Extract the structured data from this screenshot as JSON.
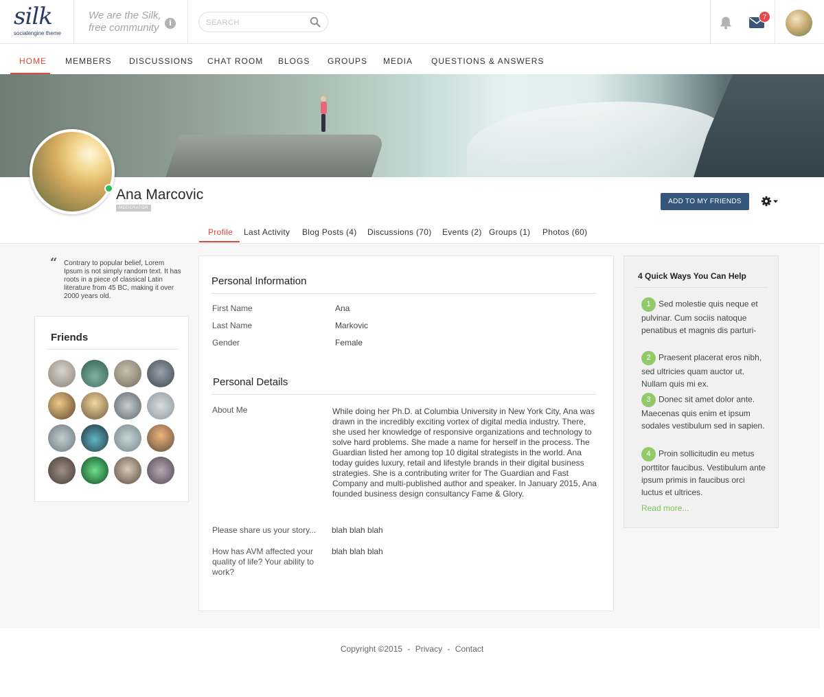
{
  "header": {
    "logo_word": "silk",
    "logo_sub": "socialengine theme",
    "tagline": "We are the Silk, free community",
    "info_glyph": "i",
    "search_placeholder": "SEARCH",
    "mail_count": "7"
  },
  "nav": {
    "items": [
      "HOME",
      "MEMBERS",
      "DISCUSSIONS",
      "CHAT ROOM",
      "BLOGS",
      "GROUPS",
      "MEDIA",
      "QUESTIONS & ANSWERS"
    ],
    "active": "HOME"
  },
  "profile": {
    "name": "Ana Marcovic",
    "badge": "MODERATOR",
    "status": "online",
    "add_friend_label": "ADD TO MY FRIENDS",
    "tabs": [
      "Profile",
      "Last Activity",
      "Blog Posts (4)",
      "Discussions (70)",
      "Events (2)",
      "Groups (1)",
      "Photos (60)"
    ],
    "active_tab": "Profile"
  },
  "quote": "Contrary to popular belief, Lorem Ipsum is not simply random text. It has roots in a piece of classical Latin literature from 45 BC, making it over 2000 years old.",
  "friends": {
    "title": "Friends",
    "count": 16
  },
  "personal_info": {
    "title": "Personal Information",
    "fields": [
      {
        "label": "First Name",
        "value": "Ana"
      },
      {
        "label": "Last Name",
        "value": "Markovic"
      },
      {
        "label": "Gender",
        "value": "Female"
      }
    ]
  },
  "personal_details": {
    "title": "Personal Details",
    "about_label": "About Me",
    "about_text": "While doing her Ph.D. at Columbia University in New York City, Ana was drawn in the incredibly exciting vortex of digital media industry. There, she used her knowledge of responsive organizations and technology to solve hard problems. She made a name for herself in the process. The Guardian listed her among top 10 digital strategists in the world. Ana today guides luxury, retail and lifestyle brands in their digital business strategies. She is a contributing writer for The Guardian and Fast Company and multi-published author and speaker. In January 2015, Ana founded business design consultancy Fame & Glory.",
    "story_label": "Please share us your story...",
    "story_value": "blah blah blah",
    "avm_label": "How has AVM affected your quality of life? Your ability to work?",
    "avm_value": "blah blah blah"
  },
  "help": {
    "title": "4 Quick Ways You Can Help",
    "items": [
      {
        "num": "1",
        "text": "Sed molestie quis neque et pulvinar. Cum sociis natoque penatibus et magnis dis parturi-"
      },
      {
        "num": "2",
        "text": "Praesent placerat eros nibh, sed ultricies quam auctor ut. Nullam quis mi ex."
      },
      {
        "num": "3",
        "text": "Donec sit amet dolor ante. Maecenas quis enim et ipsum sodales vestibulum sed in sapien."
      },
      {
        "num": "4",
        "text": "Proin sollicitudin eu metus porttitor faucibus. Vestibulum ante ipsum primis in faucibus orci luctus et ultrices."
      }
    ],
    "read_more": "Read more..."
  },
  "footer": {
    "copyright": "Copyright ©2015",
    "sep": "-",
    "privacy": "Privacy",
    "contact": "Contact"
  },
  "colors": {
    "accent": "#e2453c",
    "button": "#35557c",
    "help_green": "#92ca6a",
    "link_green": "#7ec356",
    "online": "#2bbf5a"
  }
}
